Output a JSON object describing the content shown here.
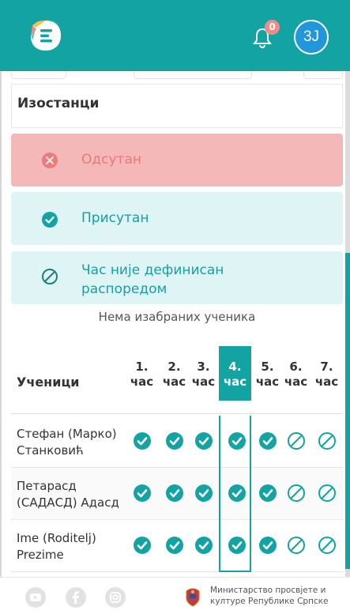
{
  "header": {
    "notification_count": "0",
    "avatar_initials": "3J"
  },
  "section": {
    "title": "Изостанци"
  },
  "statuses": [
    {
      "label": "Одсутан",
      "icon": "x-circle-icon",
      "color": "#e77a7a"
    },
    {
      "label": "Присутан",
      "icon": "check-circle-icon",
      "color": "#1a9ea0"
    },
    {
      "label": "Час није дефинисан распоредом",
      "icon": "slash-circle-icon",
      "color": "#1a9ea0"
    }
  ],
  "no_students_text": "Нема изабраних ученика",
  "table": {
    "students_header": "Ученици",
    "columns": [
      {
        "num": "1.",
        "label": "час"
      },
      {
        "num": "2.",
        "label": "час"
      },
      {
        "num": "3.",
        "label": "час"
      },
      {
        "num": "4.",
        "label": "час"
      },
      {
        "num": "5.",
        "label": "час"
      },
      {
        "num": "6.",
        "label": "час"
      },
      {
        "num": "7.",
        "label": "час"
      }
    ],
    "active_column": 4,
    "rows": [
      {
        "name": "Стефан (Марко) Станковић",
        "marks": [
          "present",
          "present",
          "present",
          "present",
          "present",
          "undefined",
          "undefined"
        ]
      },
      {
        "name": "Петарасд (САДАСД) Адасд",
        "marks": [
          "present",
          "present",
          "present",
          "present",
          "present",
          "undefined",
          "undefined"
        ]
      },
      {
        "name": "Ime (Roditelj) Prezime",
        "marks": [
          "present",
          "present",
          "present",
          "present",
          "present",
          "undefined",
          "undefined"
        ]
      }
    ]
  },
  "footer": {
    "social_icons": [
      "youtube-icon",
      "facebook-icon",
      "instagram-icon"
    ],
    "ministry_text": "Министарство просвјете и културе Републике Српске"
  },
  "colors": {
    "accent": "#14a3a3",
    "absent_bg": "#f5b8b8",
    "present_bg": "#dff4f4"
  }
}
